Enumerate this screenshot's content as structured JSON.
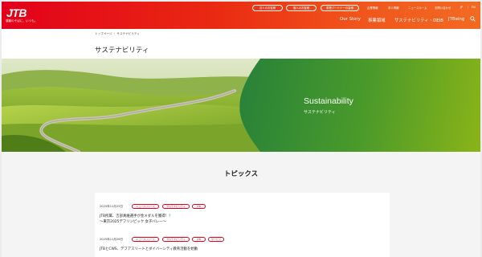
{
  "header": {
    "logo": "JTB",
    "tagline": "感動のそばに、いつも。",
    "buttons": [
      "法人のお客様",
      "個人のお客様",
      "事業パートナーの皆様"
    ],
    "util_links": [
      "企業情報",
      "求人情報",
      "ニュースルーム",
      "お問い合わせ",
      "JP",
      "EN"
    ],
    "nav": [
      "Our Story",
      "事業領域",
      "サステナビリティ・DEIB",
      "JTBeing"
    ]
  },
  "breadcrumb": "トップページ ・ サステナビリティ",
  "page_title": "サステナビリティ",
  "hero": {
    "title": "Sustainability",
    "subtitle": "サステナビリティ"
  },
  "topics": {
    "heading": "トピックス",
    "items": [
      {
        "date": "2025年11月25日",
        "tags": [
          "ニュースリリース",
          "サステナビリティ",
          "JTB"
        ],
        "title_line1": "JTB所属、吉部真維選手が金メダルを獲得！！",
        "title_line2": "～東京2025デフリンピック 女子バレー～"
      },
      {
        "date": "2025年11月26日",
        "tags": [
          "ニュースリリース",
          "サステナビリティ",
          "JTB",
          "サービス"
        ],
        "title_line1": "JTBとCWS、デフアスリートとダイバーシティ教育活動を始動",
        "title_line2": ""
      }
    ]
  },
  "colors": {
    "brand_red": "#e2001a",
    "header_orange": "#f26a22",
    "hero_green": "#1c7a3e"
  }
}
